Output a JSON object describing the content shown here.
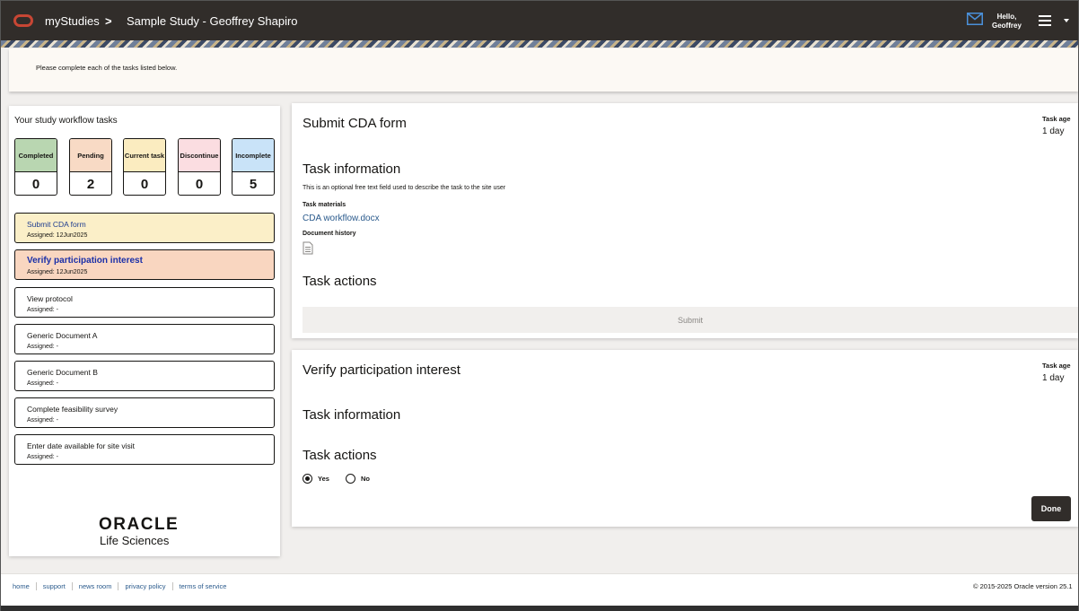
{
  "header": {
    "app_name": "myStudies",
    "separator": ">",
    "study_name": "Sample Study - Geoffrey Shapiro",
    "greeting_line1": "Hello,",
    "greeting_line2": "Geoffrey"
  },
  "intro": {
    "text": "Please complete each of the tasks listed below."
  },
  "workflow": {
    "title": "Your study workflow tasks",
    "counters": [
      {
        "label": "Completed",
        "value": "0",
        "color": "#b9d6b1"
      },
      {
        "label": "Pending",
        "value": "2",
        "color": "#f8dac5"
      },
      {
        "label": "Current task",
        "value": "0",
        "color": "#fbecc0"
      },
      {
        "label": "Discontinue",
        "value": "0",
        "color": "#fbdde1"
      },
      {
        "label": "Incomplete",
        "value": "5",
        "color": "#c9e3f8"
      }
    ],
    "tasks": [
      {
        "name": "Submit CDA form",
        "assigned": "Assigned: 12Jun2025"
      },
      {
        "name": "Verify participation interest",
        "assigned": "Assigned: 12Jun2025"
      },
      {
        "name": "View protocol",
        "assigned": "Assigned: -"
      },
      {
        "name": "Generic Document A",
        "assigned": "Assigned: -"
      },
      {
        "name": "Generic Document B",
        "assigned": "Assigned: -"
      },
      {
        "name": "Complete feasibility survey",
        "assigned": "Assigned: -"
      },
      {
        "name": "Enter date available for site visit",
        "assigned": "Assigned: -"
      }
    ],
    "brand_word": "ORACLE",
    "brand_sub": "Life Sciences"
  },
  "card_cda": {
    "title": "Submit CDA form",
    "age_label": "Task age",
    "age_value": "1 day",
    "info_title": "Task information",
    "info_text": "This is an optional free text field used to describe the task to the site user",
    "materials_label": "Task materials",
    "material_link": "CDA workflow.docx",
    "history_label": "Document history",
    "actions_title": "Task actions",
    "submit_label": "Submit"
  },
  "card_verify": {
    "title": "Verify participation interest",
    "age_label": "Task age",
    "age_value": "1 day",
    "info_title": "Task information",
    "actions_title": "Task actions",
    "yes_label": "Yes",
    "no_label": "No",
    "done_label": "Done"
  },
  "footer": {
    "links": [
      "home",
      "support",
      "news room",
      "privacy policy",
      "terms of service"
    ],
    "copyright": "© 2015-2025 Oracle version 25.1"
  },
  "colors": {
    "header_bg": "#312d2a",
    "brand_red": "#c74634",
    "link": "#2a5a8c"
  }
}
